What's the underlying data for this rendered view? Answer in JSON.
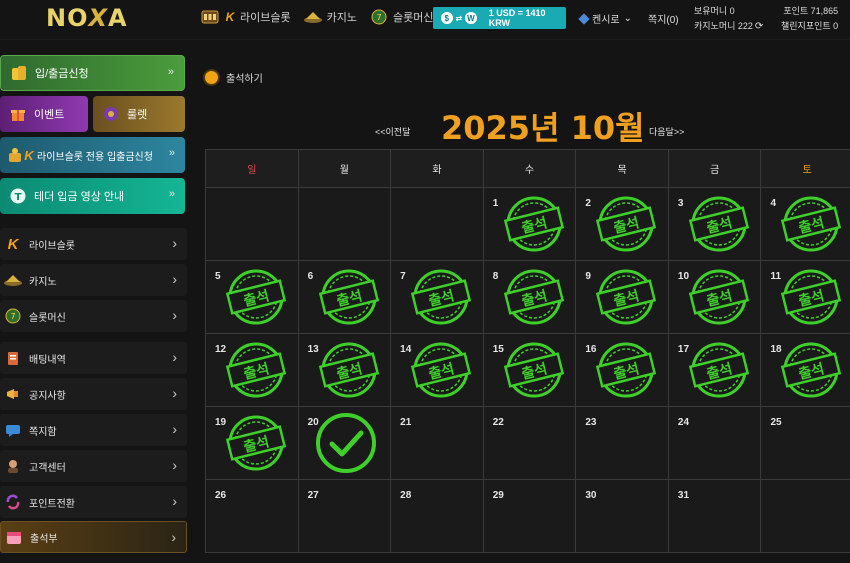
{
  "header": {
    "logo_left": "NO",
    "logo_x": "X",
    "logo_right": "A",
    "nav": [
      {
        "icon": "slot-icon",
        "label": "라이브슬롯"
      },
      {
        "icon": "casino-icon",
        "label": "카지노"
      },
      {
        "icon": "slot-machine-icon",
        "label": "슬롯머신"
      }
    ],
    "rate_text": "1 USD = 1410 KRW",
    "coin_a": "$",
    "coin_b": "W",
    "currency": "원화",
    "currency_label_visible": "켄시로",
    "messages": "쪽지(0)",
    "balance": "보유머니 0",
    "casino_money": "카지노머니 222",
    "points": "포인트 71,865",
    "challenge_points": "챌린지포인트 0",
    "accent_color": "#19aab3"
  },
  "sidebar": {
    "deposit": "입/출금신청",
    "event": "이벤트",
    "roulette": "룰렛",
    "slot_deposit": "라이브슬롯 전용 입출금신청",
    "tether": "테더 입금 영상 안내",
    "items": [
      {
        "icon": "live-slot-icon",
        "label": "라이브슬롯"
      },
      {
        "icon": "casino-icon",
        "label": "카지노"
      },
      {
        "icon": "slot-machine-icon",
        "label": "슬롯머신"
      },
      {
        "icon": "betting-icon",
        "label": "배팅내역"
      },
      {
        "icon": "megaphone-icon",
        "label": "공지사항"
      },
      {
        "icon": "message-icon",
        "label": "쪽지함"
      },
      {
        "icon": "support-icon",
        "label": "고객센터"
      },
      {
        "icon": "exchange-icon",
        "label": "포인트전환"
      },
      {
        "icon": "calendar-icon",
        "label": "출석부"
      }
    ]
  },
  "main": {
    "section_label": "출석하기",
    "prev": "<<이전달",
    "month_title": "2025년 10월",
    "next": "다음달>>",
    "days_of_week": [
      "일",
      "월",
      "화",
      "수",
      "목",
      "금",
      "토"
    ],
    "stamp_text": "출석",
    "weeks": [
      [
        null,
        null,
        null,
        1,
        2,
        3,
        4
      ],
      [
        5,
        6,
        7,
        8,
        9,
        10,
        11
      ],
      [
        12,
        13,
        14,
        15,
        16,
        17,
        18
      ],
      [
        19,
        20,
        21,
        22,
        23,
        24,
        25
      ],
      [
        26,
        27,
        28,
        29,
        30,
        31,
        null
      ]
    ],
    "attended_days": [
      1,
      2,
      3,
      4,
      5,
      6,
      7,
      8,
      9,
      10,
      11,
      12,
      13,
      14,
      15,
      16,
      17,
      18,
      19
    ],
    "today": 20,
    "stamp_color": "#3ecf2a",
    "title_color": "#f0a020"
  }
}
